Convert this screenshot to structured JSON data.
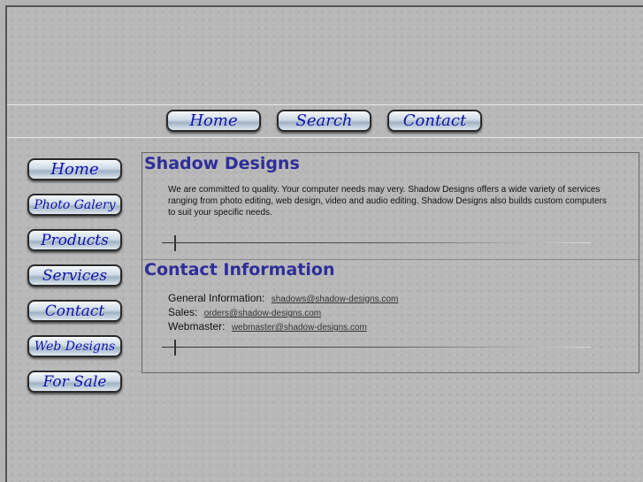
{
  "top_nav": [
    {
      "label": "Home"
    },
    {
      "label": "Search"
    },
    {
      "label": "Contact"
    }
  ],
  "side_nav": [
    {
      "label": "Home"
    },
    {
      "label": "Photo Galery"
    },
    {
      "label": "Products"
    },
    {
      "label": "Services"
    },
    {
      "label": "Contact"
    },
    {
      "label": "Web Designs"
    },
    {
      "label": "For Sale"
    }
  ],
  "intro": {
    "title": "Shadow Designs",
    "text": "We are committed to quality.  Your computer needs may very.  Shadow Designs offers a wide variety of services ranging from photo editing, web design, video and audio editing.  Shadow Designs also builds custom computers to suit your specific needs."
  },
  "contact": {
    "title": "Contact Information",
    "rows": [
      {
        "label": "General Information:",
        "email": "shadows@shadow-designs.com"
      },
      {
        "label": "Sales:",
        "email": "orders@shadow-designs.com"
      },
      {
        "label": "Webmaster:",
        "email": "webmaster@shadow-designs.com"
      }
    ]
  }
}
